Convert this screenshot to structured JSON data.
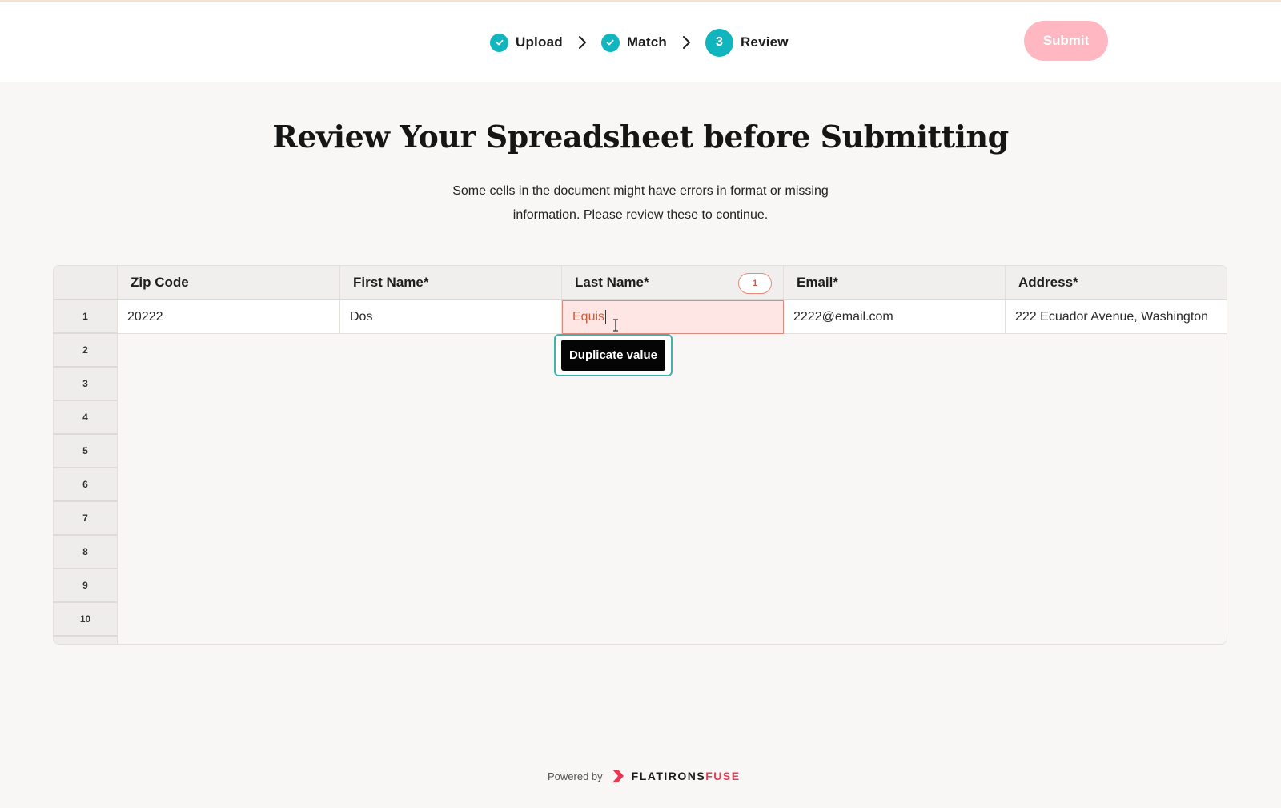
{
  "header": {
    "steps": [
      {
        "label": "Upload",
        "status": "complete",
        "icon": "check-icon"
      },
      {
        "label": "Match",
        "status": "complete",
        "icon": "check-icon"
      },
      {
        "label": "Review",
        "status": "current",
        "number": "3"
      }
    ],
    "submit_label": "Submit"
  },
  "main": {
    "title": "Review Your Spreadsheet before Submitting",
    "subtitle_line1": "Some cells in the document might have errors in format or missing",
    "subtitle_line2": "information. Please review these to continue."
  },
  "grid": {
    "columns": [
      {
        "label": "Zip Code"
      },
      {
        "label": "First Name*"
      },
      {
        "label": "Last Name*",
        "error_count": "1"
      },
      {
        "label": "Email*"
      },
      {
        "label": "Address*"
      }
    ],
    "row_numbers": [
      "1",
      "2",
      "3",
      "4",
      "5",
      "6",
      "7",
      "8",
      "9",
      "10"
    ],
    "rows": [
      {
        "zip_code": "20222",
        "first_name": "Dos",
        "last_name": "Equis",
        "email": "2222@email.com",
        "address": "222 Ecuador Avenue, Washington"
      }
    ],
    "tooltip": "Duplicate value"
  },
  "footer": {
    "powered_by": "Powered by",
    "brand_part1": "FLATIRONS",
    "brand_part2": "FUSE"
  },
  "colors": {
    "accent": "#11b5bd",
    "submit_disabled": "#ffb7c2",
    "error_bg": "#fde6e3",
    "error_border": "#e08a7d",
    "brand_red": "#e63a53"
  }
}
